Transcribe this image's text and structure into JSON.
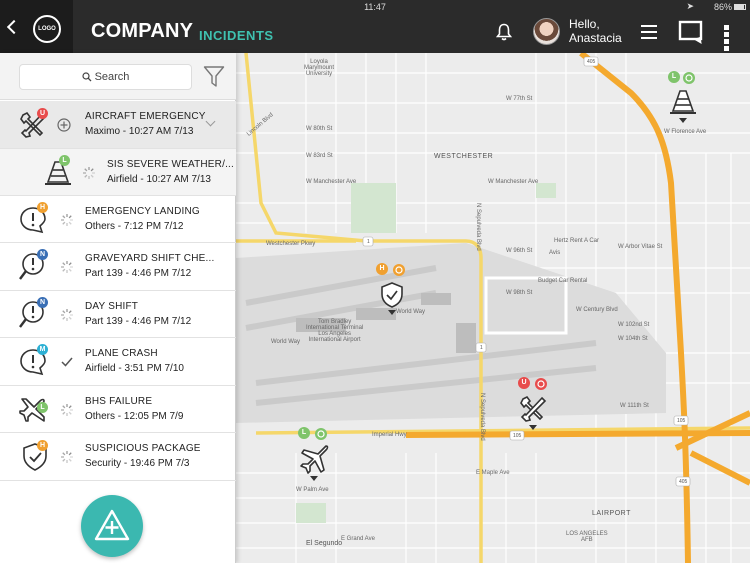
{
  "statusbar": {
    "time": "11:47",
    "battery": "86%"
  },
  "header": {
    "logo": "LOGO",
    "title_company": "COMPANY",
    "title_section": "INCIDENTS",
    "greeting_line1": "Hello,",
    "greeting_line2": "Anastacia"
  },
  "sidebar": {
    "search_label": "Search",
    "incidents": [
      {
        "title": "AIRCRAFT EMERGENCY",
        "subtitle": "Maximo - 10:27 AM 7/13",
        "badge": "U",
        "badge_color": "#e84c4c",
        "icon": "tools-icon",
        "status": "plus-circle-icon"
      },
      {
        "title": "SIS SEVERE WEATHER/...",
        "subtitle": "Airfield - 10:27 AM 7/13",
        "badge": "L",
        "badge_color": "#7fc46b",
        "icon": "cone-icon",
        "status": "loading-icon"
      },
      {
        "title": "EMERGENCY LANDING",
        "subtitle": "Others - 7:12 PM 7/12",
        "badge": "H",
        "badge_color": "#f0a030",
        "icon": "alert-bubble-icon",
        "status": "loading-icon"
      },
      {
        "title": "GRAVEYARD SHIFT CHE...",
        "subtitle": "Part 139  - 4:46 PM 7/12",
        "badge": "N",
        "badge_color": "#3a6fb5",
        "icon": "search-alert-icon",
        "status": "loading-icon"
      },
      {
        "title": "DAY SHIFT",
        "subtitle": "Part 139  - 4:46 PM 7/12",
        "badge": "N",
        "badge_color": "#3a6fb5",
        "icon": "search-alert-icon",
        "status": "loading-icon"
      },
      {
        "title": "PLANE CRASH",
        "subtitle": "Airfield - 3:51 PM 7/10",
        "badge": "M",
        "badge_color": "#2db0d4",
        "icon": "alert-bubble-icon",
        "status": "check-icon"
      },
      {
        "title": "BHS FAILURE",
        "subtitle": "Others - 12:05 PM 7/9",
        "badge": "L",
        "badge_color": "#7fc46b",
        "icon": "plane-icon",
        "status": "loading-icon"
      },
      {
        "title": "SUSPICIOUS PACKAGE",
        "subtitle": "Security - 19:46 PM 7/3",
        "badge": "H",
        "badge_color": "#f0a030",
        "icon": "shield-icon",
        "status": "loading-icon"
      }
    ]
  },
  "map": {
    "labels": {
      "loyola": "Loyola\nMarymount\nUniversity",
      "westchester": "WESTCHESTER",
      "w_manchester": "W Manchester Ave",
      "westchester_pkwy": "Westchester Pkwy",
      "w_century": "W Century Blvd",
      "world_way": "World Way",
      "tom_bradley": "Tom Bradley\nInternational Terminal\nLos Angeles\nInternational Airport",
      "imperial": "Imperial Hwy",
      "el_segundo": "El Segundo",
      "lairport": "LAIRPORT",
      "los_angeles_afb": "LOS ANGELES\nAFB",
      "hertz": "Hertz Rent A Car",
      "avis": "Avis",
      "budget": "Budget Car Rental",
      "sepulveda": "N Sepulveda Blvd",
      "lincoln": "Lincoln Blvd",
      "w_florence": "W Florence Ave",
      "w_arbor_vitae": "W Arbor Vitae St",
      "w_96th": "W 96th St",
      "w_98th": "W 98th St",
      "w_102nd": "W 102nd St",
      "w_104th": "W 104th St",
      "w_111th": "W 111th St",
      "w_maple": "E Maple Ave",
      "e_grand": "E Grand Ave",
      "w_palm": "W Palm Ave",
      "w_80th": "W 80th St",
      "w_83rd": "W 83rd St",
      "w_77th": "W 77th St"
    },
    "pins": [
      {
        "badge1": "L",
        "badge1_color": "#7fc46b",
        "icon": "cone-icon"
      },
      {
        "badge1": "H",
        "badge1_color": "#f0a030",
        "icon": "shield-icon"
      },
      {
        "badge1": "U",
        "badge1_color": "#e84c4c",
        "icon": "tools-icon"
      },
      {
        "badge1": "L",
        "badge1_color": "#7fc46b",
        "icon": "plane-icon"
      }
    ],
    "road_shields": [
      "405",
      "1",
      "1",
      "105",
      "105",
      "405"
    ]
  }
}
